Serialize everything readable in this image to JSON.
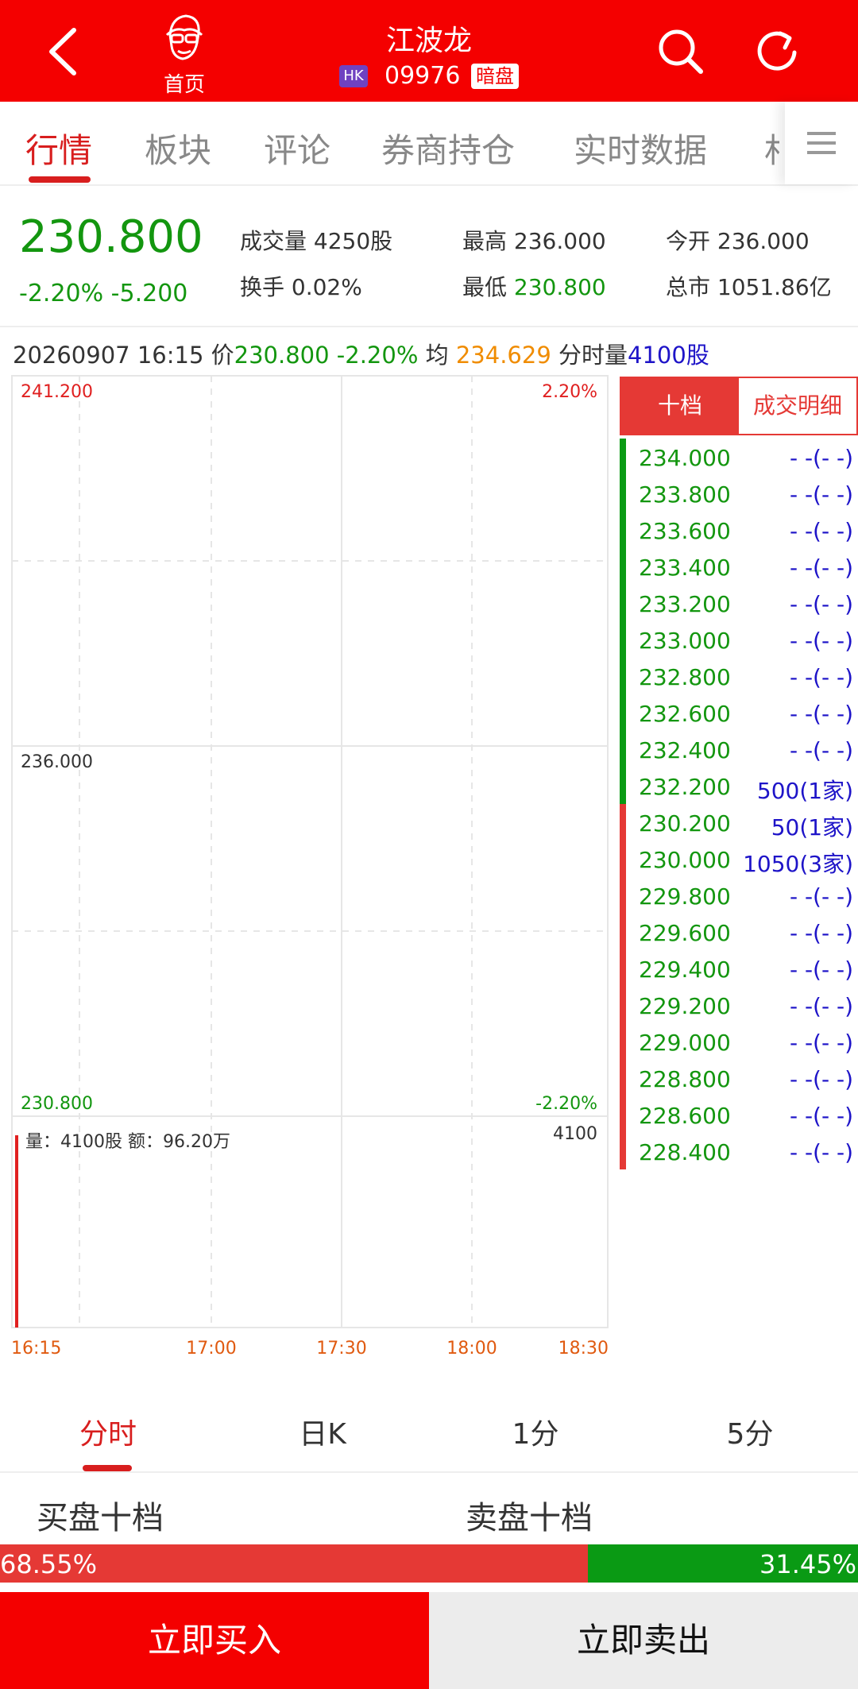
{
  "colors": {
    "brand_red": "#f40000",
    "up_green": "#13960f",
    "avg_orange": "#f08c00",
    "volume_purple": "#1e14c8"
  },
  "header": {
    "back_icon": "chevron-left-icon",
    "home_label": "首页",
    "title": "江波龙",
    "market_badge": "HK",
    "code": "09976",
    "session_badge": "暗盘",
    "search_icon": "search-icon",
    "refresh_icon": "refresh-icon"
  },
  "tabs": [
    {
      "label": "行情",
      "active": true
    },
    {
      "label": "板块"
    },
    {
      "label": "评论"
    },
    {
      "label": "券商持仓"
    },
    {
      "label": "实时数据"
    },
    {
      "label": "村"
    }
  ],
  "summary": {
    "price": "230.800",
    "change": "-2.20% -5.200",
    "volume": "成交量 4250股",
    "turnover": "换手 0.02%",
    "high_label": "最高",
    "high": "236.000",
    "low_label": "最低",
    "low": "230.800",
    "open": "今开 236.000",
    "mktcap": "总市 1051.86亿"
  },
  "infoline": {
    "datetime": "20260907 16:15",
    "price_label": "价",
    "price": "230.800",
    "pct": "-2.20%",
    "avg_label": "均",
    "avg": "234.629",
    "vol_label": "分时量",
    "vol": "4100股"
  },
  "chart_labels": {
    "price_top": "241.200",
    "pct_top": "2.20%",
    "price_mid": "236.000",
    "price_bottom": "230.800",
    "pct_bottom": "-2.20%",
    "vol_info": "量：4100股 额：96.20万",
    "vol_max": "4100",
    "times": [
      "16:15",
      "17:00",
      "17:30",
      "18:00",
      "18:30"
    ]
  },
  "chart_data": {
    "type": "line",
    "ylim": [
      230.8,
      241.2
    ],
    "x": [
      "16:15"
    ],
    "series": [
      {
        "values": [
          230.8
        ]
      }
    ],
    "volume": [
      4100
    ]
  },
  "order_book": {
    "tab_ten": "十档",
    "tab_detail": "成交明细",
    "sell": [
      {
        "price": "234.000",
        "vol": "- -(- -)"
      },
      {
        "price": "233.800",
        "vol": "- -(- -)"
      },
      {
        "price": "233.600",
        "vol": "- -(- -)"
      },
      {
        "price": "233.400",
        "vol": "- -(- -)"
      },
      {
        "price": "233.200",
        "vol": "- -(- -)"
      },
      {
        "price": "233.000",
        "vol": "- -(- -)"
      },
      {
        "price": "232.800",
        "vol": "- -(- -)"
      },
      {
        "price": "232.600",
        "vol": "- -(- -)"
      },
      {
        "price": "232.400",
        "vol": "- -(- -)"
      },
      {
        "price": "232.200",
        "vol": "500(1家)"
      }
    ],
    "buy": [
      {
        "price": "230.200",
        "vol": "50(1家)"
      },
      {
        "price": "230.000",
        "vol": "1050(3家)"
      },
      {
        "price": "229.800",
        "vol": "- -(- -)"
      },
      {
        "price": "229.600",
        "vol": "- -(- -)"
      },
      {
        "price": "229.400",
        "vol": "- -(- -)"
      },
      {
        "price": "229.200",
        "vol": "- -(- -)"
      },
      {
        "price": "229.000",
        "vol": "- -(- -)"
      },
      {
        "price": "228.800",
        "vol": "- -(- -)"
      },
      {
        "price": "228.600",
        "vol": "- -(- -)"
      },
      {
        "price": "228.400",
        "vol": "- -(- -)"
      }
    ]
  },
  "periods": [
    {
      "label": "分时",
      "active": true
    },
    {
      "label": "日K"
    },
    {
      "label": "1分"
    },
    {
      "label": "5分"
    }
  ],
  "book_titles": {
    "buy": "买盘十档",
    "sell": "卖盘十档"
  },
  "ratio": {
    "buy_pct": 68.55,
    "sell_pct": 31.45,
    "buy_label": "68.55%",
    "sell_label": "31.45%"
  },
  "actions": {
    "buy": "立即买入",
    "sell": "立即卖出"
  }
}
